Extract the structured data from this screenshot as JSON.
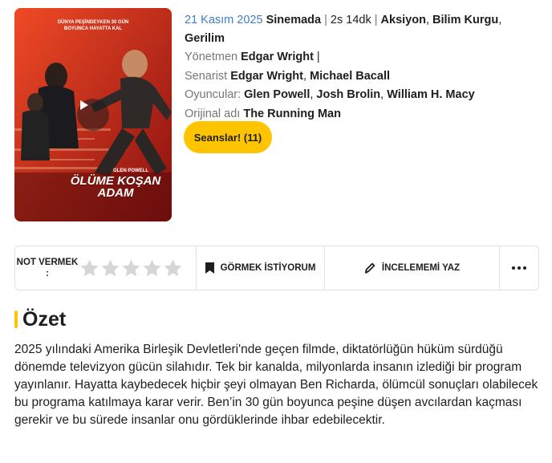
{
  "movie": {
    "release_date": "21 Kasım 2025",
    "status": "Sinemada",
    "duration": "2s 14dk",
    "genres": [
      "Aksiyon",
      "Bilim Kurgu",
      "Gerilim"
    ],
    "director_label": "Yönetmen",
    "director": "Edgar Wright",
    "writer_label": "Senarist",
    "writers": [
      "Edgar Wright",
      "Michael Bacall"
    ],
    "cast_label": "Oyuncular:",
    "cast": [
      "Glen Powell",
      "Josh Brolin",
      "William H. Macy"
    ],
    "original_title_label": "Orijinal adı",
    "original_title": "The Running Man"
  },
  "poster": {
    "top_text": "DÜNYA PEŞİNDEYKEN 30 GÜN BOYUNCA HAYATTA KAL",
    "actor": "GLEN POWELL",
    "title": "ÖLÜME KOŞAN ADAM"
  },
  "sessions_button": "Seanslar! (11)",
  "actionbar": {
    "rate_label": "NOT VERMEK :",
    "stars": 5,
    "rating_value": 0,
    "watchlist_label": "GÖRMEK İSTİYORUM",
    "review_label": "İNCELEMEMİ YAZ"
  },
  "summary": {
    "title": "Özet",
    "text": "2025 yılındaki Amerika Birleşik Devletleri'nde geçen filmde, diktatörlüğün hüküm sürdüğü dönemde televizyon gücün silahıdır. Tek bir kanalda, milyonlarda insanın izlediği bir program yayınlanır. Hayatta kaybedecek hiçbir şeyi olmayan Ben Richarda, ölümcül sonuçları olabilecek bu programa katılmaya karar verir. Ben’in 30 gün boyunca peşine düşen avcılardan kaçması gerekir ve bu sürede insanlar onu gördüklerinde ihbar edebilecektir."
  },
  "colors": {
    "accent": "#ffc400",
    "link_blue": "#3d7dca",
    "muted": "#767676",
    "star_empty": "#d6d6d6"
  }
}
